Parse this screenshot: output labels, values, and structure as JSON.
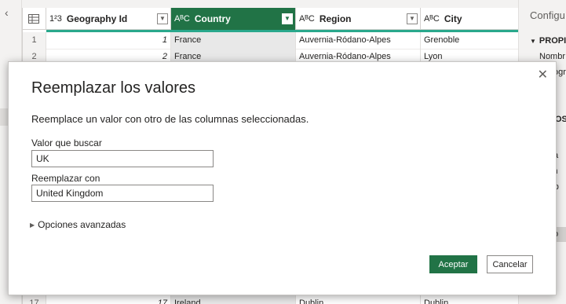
{
  "grid": {
    "columns": [
      {
        "type_glyph": "1²3",
        "name": "Geography Id"
      },
      {
        "type_glyph": "AᴮC",
        "name": "Country"
      },
      {
        "type_glyph": "AᴮC",
        "name": "Region"
      },
      {
        "type_glyph": "AᴮC",
        "name": "City"
      }
    ],
    "rows": [
      {
        "num": "1",
        "id": "1",
        "country": "France",
        "region": "Auvernia-Ródano-Alpes",
        "city": "Grenoble"
      },
      {
        "num": "2",
        "id": "2",
        "country": "France",
        "region": "Auvernia-Ródano-Alpes",
        "city": "Lyon"
      },
      {
        "num": "17",
        "id": "17",
        "country": "Ireland",
        "region": "Dublin",
        "city": "Dublin"
      }
    ]
  },
  "right_pane": {
    "title": "Configu",
    "section": "PROPI",
    "name_label": "Nombr",
    "partial_1": "ogr",
    "link": "as",
    "steps_header": "OS",
    "steps": [
      "Or",
      "Na",
      "En",
      "Tip",
      "Pr",
      "Te",
      "Co"
    ]
  },
  "dialog": {
    "title": "Reemplazar los valores",
    "description": "Reemplace un valor con otro de las columnas seleccionadas.",
    "find_label": "Valor que buscar",
    "find_value": "UK",
    "replace_label": "Reemplazar con",
    "replace_value": "United Kingdom",
    "advanced_label": "Opciones avanzadas",
    "ok_label": "Aceptar",
    "cancel_label": "Cancelar"
  },
  "colors": {
    "accent": "#217346",
    "quality_bar": "#2aa88c"
  }
}
